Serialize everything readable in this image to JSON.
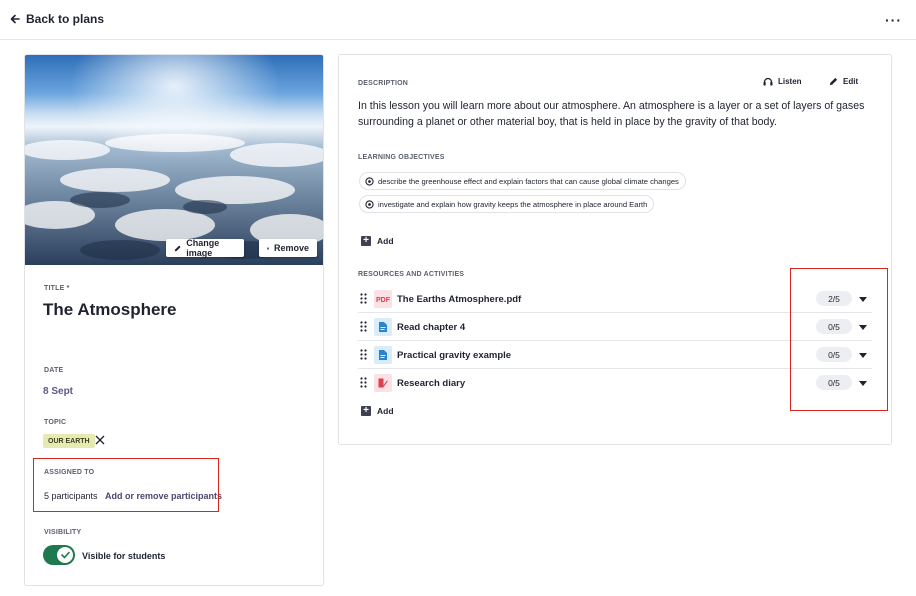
{
  "header": {
    "back_label": "Back to plans",
    "more_label": "···"
  },
  "image_actions": {
    "change_label": "Change image",
    "remove_label": "Remove"
  },
  "details": {
    "title_label": "TITLE *",
    "title_value": "The Atmosphere",
    "date_label": "DATE",
    "date_value": "8 Sept",
    "topic_label": "TOPIC",
    "topic_tag": "OUR EARTH",
    "assigned_label": "ASSIGNED TO",
    "participants_count": "5 participants",
    "participants_link": "Add or remove participants",
    "visibility_label": "VISIBILITY",
    "visibility_toggle_label": "Visible for students",
    "visibility_on": true
  },
  "description": {
    "section_label": "DESCRIPTION",
    "listen_label": "Listen",
    "edit_label": "Edit",
    "text": "In this lesson you will learn more about our atmosphere. An atmosphere is a layer or a set of layers of gases surrounding a planet or other material boy, that is held in place by the gravity of that body."
  },
  "objectives": {
    "section_label": "LEARNING OBJECTIVES",
    "items": [
      "describe the greenhouse effect and explain factors that can cause global climate changes",
      "investigate and explain how gravity keeps the atmosphere in place around Earth"
    ],
    "add_label": "Add"
  },
  "resources": {
    "section_label": "RESOURCES AND ACTIVITIES",
    "items": [
      {
        "name": "The Earths Atmosphere.pdf",
        "icon": "pdf-icon",
        "count": "2/5"
      },
      {
        "name": "Read chapter 4",
        "icon": "document-icon",
        "count": "0/5"
      },
      {
        "name": "Practical gravity example",
        "icon": "document-icon",
        "count": "0/5"
      },
      {
        "name": "Research diary",
        "icon": "diary-icon",
        "count": "0/5"
      }
    ],
    "add_label": "Add"
  },
  "colors": {
    "accent_green": "#1e7a4e",
    "link_purple": "#4b4770",
    "highlight_red": "#d9251c",
    "topic_tag_bg": "#e5eab0"
  }
}
